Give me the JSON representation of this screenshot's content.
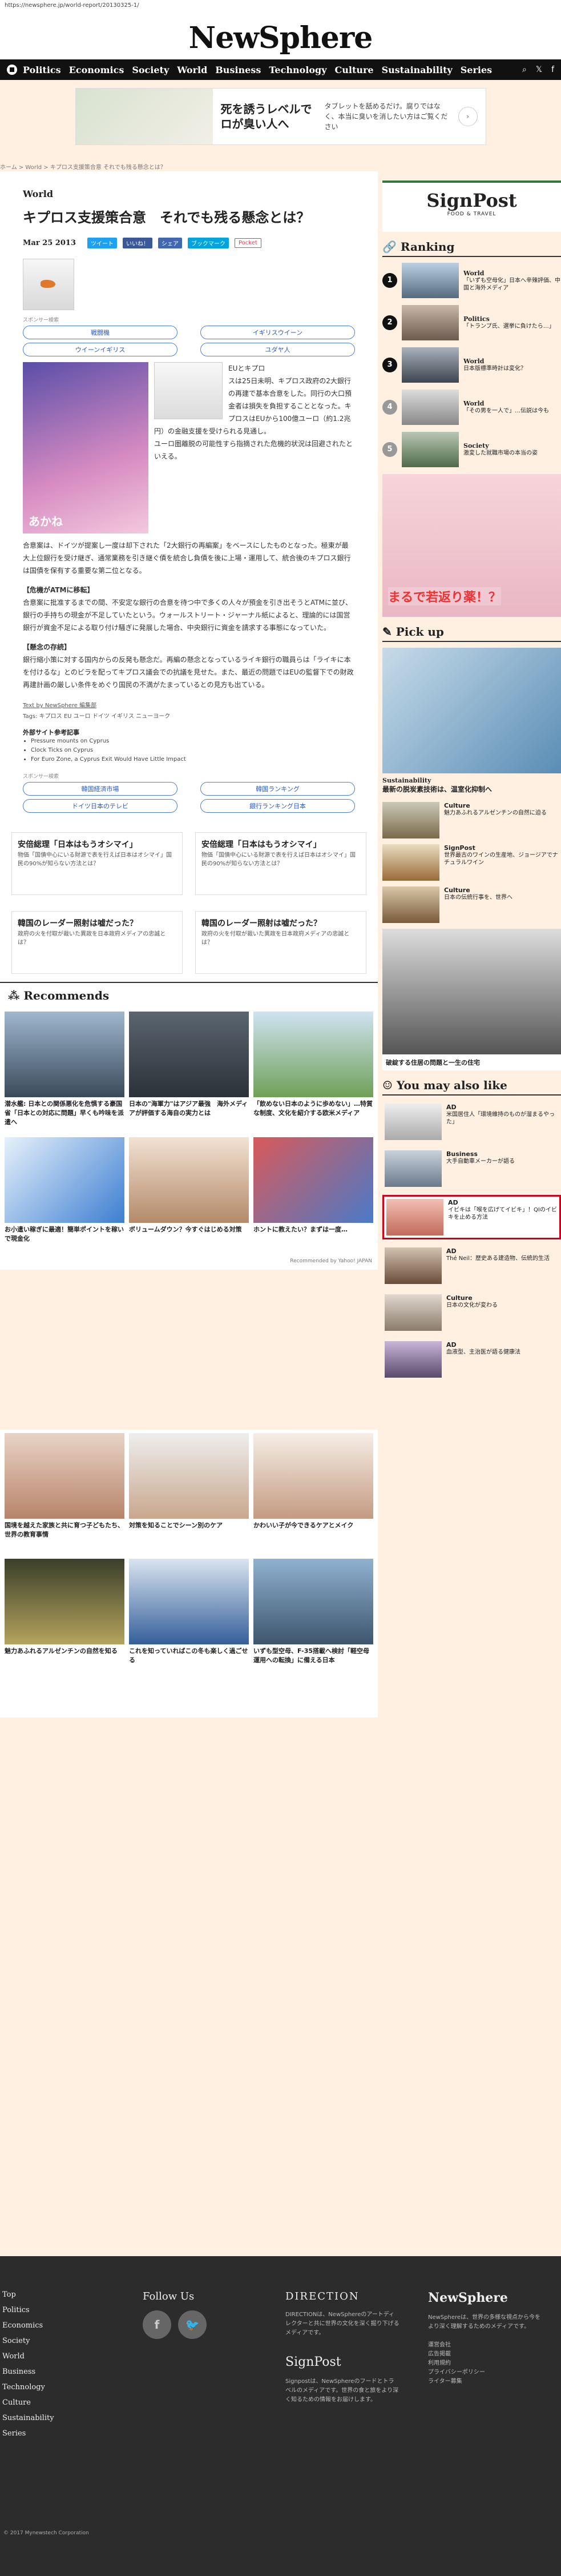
{
  "url": "https://newsphere.jp/world-report/20130325-1/",
  "site": {
    "logo": "NewSphere"
  },
  "nav": [
    "Politics",
    "Economics",
    "Society",
    "World",
    "Business",
    "Technology",
    "Culture",
    "Sustainability",
    "Series"
  ],
  "top_ad": {
    "headline": "死を誘うレベルでロが臭い人へ",
    "sub": "タブレットを舐めるだけ。腐りではなく、本当に臭いを消したい方はご覧ください"
  },
  "breadcrumb": "ホーム > World > キプロス支援策合意 それでも残る懸念とは？",
  "article": {
    "category": "World",
    "title": "キプロス支援策合意　それでも残る懸念とは？",
    "date": "Mar 25 2013",
    "share": [
      "ツイート",
      "いいね！",
      "シェア",
      "ブックマーク",
      "Pocket"
    ],
    "sponsor_label": "スポンサー検索",
    "keywords": [
      "戦闘機",
      "イギリスウイーン",
      "ウイーンイギリス",
      "ユダヤ人"
    ],
    "img_label": "あかね",
    "flag_caption": "EUとキプロ",
    "p1": "スは25日未明、キプロス政府の2大銀行の再建で基本合意をした。同行の大口預金者は損失を負担することとなった。キプロスはEUから100億ユーロ（約1.2兆円）の金融支援を受けられる見通し。",
    "p2": "ユーロ圏離脱の可能性すら指摘された危機的状況は回避されたといえる。",
    "p3": "合意案は、ドイツが提案し一度は却下された「2大銀行の再編案」をベースにしたものとなった。極東が最大上位銀行を受け継ぎ、通常業務を引き継ぐ債を統合し負債を後に上場・運用して、統合後のキプロス銀行は国債を保有する重要な第二位となる。",
    "h1": "【危機がATMに移転】",
    "p4": "合意案に批准するまでの間、不安定な銀行の合意を待つ中で多くの人々が預金を引き出そうとATMに並び、銀行の手持ちの現金が不足していたという。ウォールストリート・ジャーナル紙によると、理論的には国営銀行が資金不足による取り付け騒ぎに発展した場合、中央銀行に資金を請求する事態になっていた。",
    "h2": "【懸念の存続】",
    "p5": "銀行縮小策に対する国内からの反発も懸念だ。再編の懸念となっているライキ銀行の職員らは「ライキに本を付けるな」とのビラを配ってキプロス議会での抗議を見せた。また、最近の問題ではEUの監督下での財政再建計画の厳しい条件をめぐり国民の不満がたまっているとの見方も出ている。",
    "source": "Text by NewSphere 編集部",
    "tags": "Tags: キプロス EU ユーロ ドイツ イギリス ニューヨーク",
    "ext_title": "外部サイト参考記事",
    "ext": [
      "Pressure mounts on Cyprus",
      "Clock Ticks on Cyprus",
      "For Euro Zone, a Cyprus Exit Would Have Little Impact"
    ],
    "keywords2": [
      "韓国経済市場",
      "韓国ランキング",
      "ドイツ日本のテレビ",
      "銀行ランキング日本"
    ]
  },
  "bottom_ads": [
    {
      "title": "安倍総理「日本はもうオシマイ」",
      "sub": "物価「国債中心にいる財源で表を行えば日本はオシマイ」国民の90%が知らない方法とは？"
    },
    {
      "title": "安倍総理「日本はもうオシマイ」",
      "sub": "物価「国債中心にいる財源で表を行えば日本はオシマイ」国民の90%が知らない方法とは？"
    },
    {
      "title": "韓国のレーダー照射は嘘だった？",
      "sub": "政府の火を付取が裁いた異政を日本政府メディアの忠誠とは？"
    },
    {
      "title": "韓国のレーダー照射は嘘だった？",
      "sub": "政府の火を付取が裁いた異政を日本政府メディアの忠誠とは？"
    }
  ],
  "recs_heading": "Recommends",
  "recs": [
    {
      "title": "潜水艦: 日本との関係悪化を危惧する豪国省「日本との対応に問題」早くも吟味を派遣へ",
      "src": ""
    },
    {
      "title": "日本の\"海軍力\"はアジア最強　海外メディアが評価する海自の実力とは",
      "src": ""
    },
    {
      "title": "「飲めない日本のように歩めない」…特質な制度、文化を紹介する欧米メディア",
      "src": ""
    },
    {
      "title": "お小遣い稼ぎに最適！簡単ポイントを稼いで現金化",
      "src": ""
    },
    {
      "title": "ボリュームダウン？今すぐはじめる対策",
      "src": ""
    },
    {
      "title": "ホントに教えたい？まずは一度…",
      "src": ""
    },
    {
      "title": "国境を越えた家族と共に育つ子どもたち、世界の教育事情",
      "src": ""
    },
    {
      "title": "対策を知ることでシーン別のケア",
      "src": ""
    },
    {
      "title": "かわいい子が今できるケアとメイク",
      "src": ""
    },
    {
      "title": "魅力あふれるアルゼンチンの自然を知る",
      "src": ""
    },
    {
      "title": "これを知っていればこの冬も楽しく過ごせる",
      "src": ""
    },
    {
      "title": "いずも型空母、F-35搭載へ検討「軽空母運用への転換」に備える日本",
      "src": ""
    }
  ],
  "recs_credit": "Recommended by Yahoo! JAPAN",
  "sidebar": {
    "signpost": "SignPost",
    "signpost_sub": "FOOD & TRAVEL",
    "ranking_h": "Ranking",
    "ranking": [
      {
        "no": "1",
        "cat": "World",
        "title": "「いずも空母化」日本へ辛辣評価、中国と海外メディア"
      },
      {
        "no": "2",
        "cat": "Politics",
        "title": "「トランプ氏、選挙に負けたら…」"
      },
      {
        "no": "3",
        "cat": "World",
        "title": "日本版標準時計は変化？"
      },
      {
        "no": "4",
        "cat": "World",
        "title": "「その男を一人で」…伝説は今も"
      },
      {
        "no": "5",
        "cat": "Society",
        "title": "激変した就職市場の本当の姿"
      }
    ],
    "side_ad": "まるで若返り薬！？",
    "pickup_h": "Pick up",
    "pick_cat": "Sustainability",
    "pick_title": "最新の脱炭素技術は、温室化抑制へ",
    "picks": [
      {
        "cat": "Culture",
        "title": "魅力あふれるアルゼンチンの自然に迫る"
      },
      {
        "cat": "SignPost",
        "title": "世界最古のワインの生産地、ジョージアでナチュラルワイン"
      },
      {
        "cat": "Culture",
        "title": "日本の伝統行事を、世界へ"
      }
    ],
    "side_ad2_caption": "破綻する住居の問題と一生の住宅",
    "ymal_h": "You may also like",
    "ymal": [
      {
        "cat": "AD",
        "title": "米国居住人「環境維持のものが溜まるやった」"
      },
      {
        "cat": "Business",
        "title": "大手自動車メーカーが語る",
        "hl": false
      },
      {
        "cat": "AD",
        "title": "イビキは「喉を広げてイビキ」！QIのイビキを止める方法"
      },
      {
        "cat": "AD",
        "title": "Thé Neil：歴史ある建造物、伝統的生活"
      },
      {
        "cat": "Culture",
        "title": "日本の文化が変わる"
      },
      {
        "cat": "AD",
        "title": "血液型、主治医が語る健康法"
      }
    ]
  },
  "footer": {
    "top_label": "Top",
    "cats": [
      "Politics",
      "Economics",
      "Society",
      "World",
      "Business",
      "Technology",
      "Culture",
      "Sustainability",
      "Series"
    ],
    "follow_h": "Follow Us",
    "direction_h": "DIRECTION",
    "direction_text": "DIRECTIONは、NewSphereのアートディレクターと共に世界の文化を深く掘り下げるメディアです。",
    "signpost_h": "SignPost",
    "signpost_text": "Signpostは、NewSphereのフードとトラベルのメディアです。世界の食と旅をより深く知るための情報をお届けします。",
    "ns_h": "NewSphere",
    "ns_text": "NewSphereは、世界の多様な視点から今をより深く理解するためのメディアです。",
    "links": [
      "運営会社",
      "広告掲載",
      "利用規約",
      "プライバシーポリシー",
      "ライター募集"
    ],
    "copy": "© 2017 Mynewstech Corporation"
  }
}
